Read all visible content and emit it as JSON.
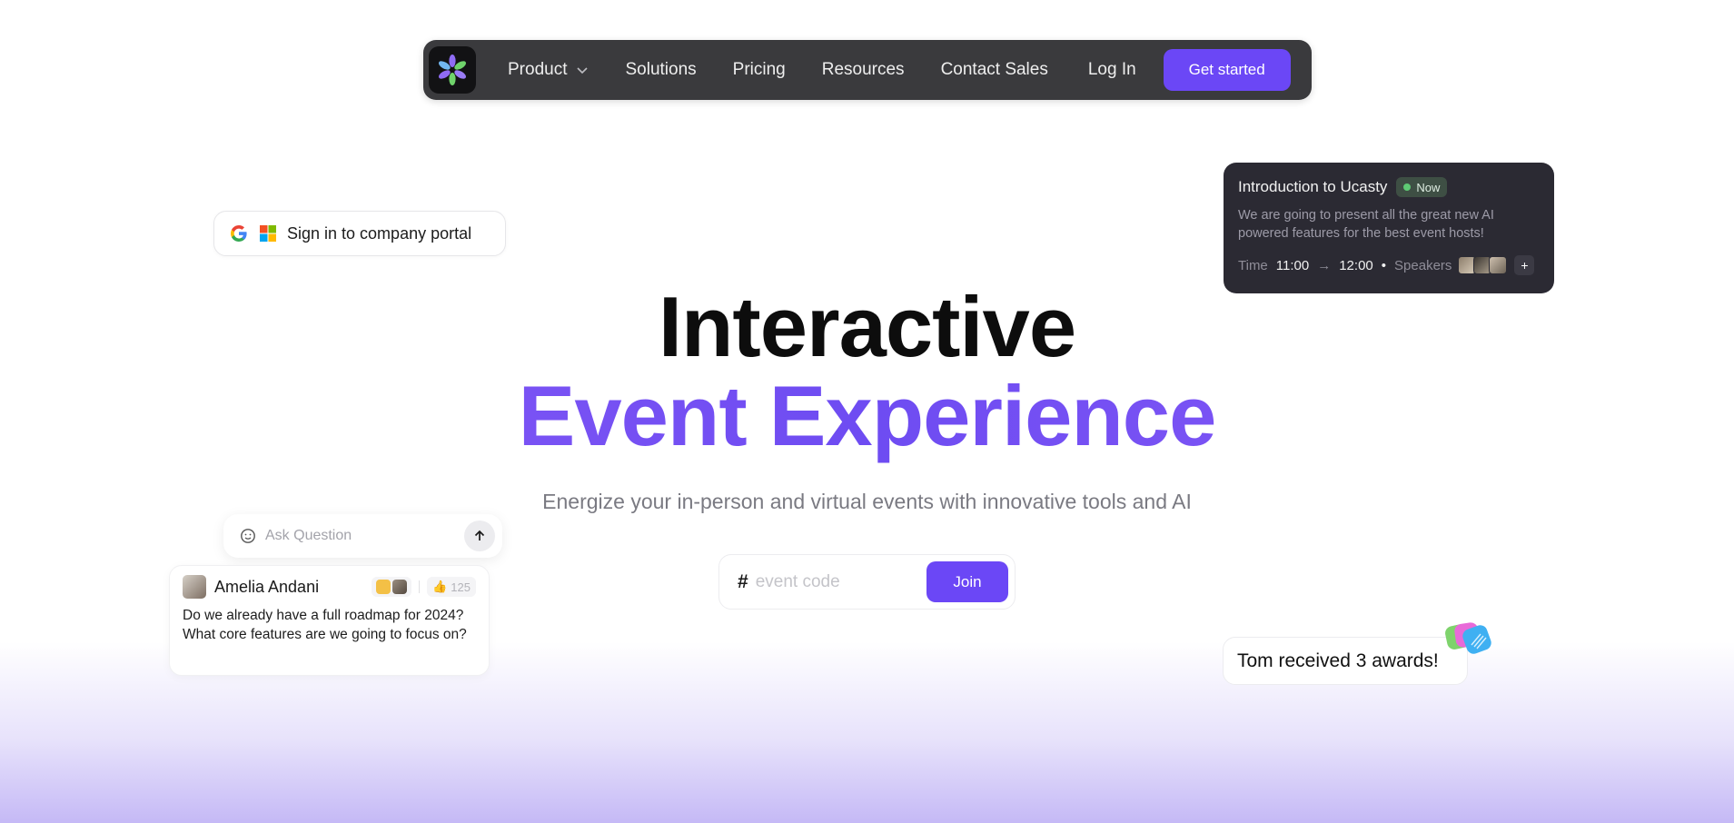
{
  "nav": {
    "items": [
      {
        "label": "Product",
        "has_dropdown": true
      },
      {
        "label": "Solutions"
      },
      {
        "label": "Pricing"
      },
      {
        "label": "Resources"
      },
      {
        "label": "Contact Sales"
      }
    ],
    "login_label": "Log In",
    "cta_label": "Get started"
  },
  "signin": {
    "label": "Sign in to company portal",
    "icons": [
      "google-icon",
      "microsoft-icon"
    ]
  },
  "event_card": {
    "title": "Introduction to Ucasty",
    "badge": "Now",
    "description": "We are going to present all the great new AI powered features for the best event hosts!",
    "time_label": "Time",
    "start": "11:00",
    "arrow": "→",
    "end": "12:00",
    "bullet": "•",
    "speakers_label": "Speakers",
    "plus": "+"
  },
  "hero": {
    "line1": "Interactive",
    "line2": "Event Experience",
    "subtitle": "Energize your in-person and virtual events with innovative tools and AI"
  },
  "event_code": {
    "hash": "#",
    "placeholder": "event code",
    "join_label": "Join"
  },
  "ask": {
    "placeholder": "Ask Question"
  },
  "question": {
    "author": "Amelia Andani",
    "likes": "125",
    "text": "Do we already have a full roadmap for 2024? What core features are we going to focus on?"
  },
  "award": {
    "text": "Tom received 3 awards!"
  },
  "colors": {
    "accent": "#6b47f6",
    "nav_bg": "#3a3a3d",
    "card_bg": "#2b2a33",
    "now_green": "#5ecb74"
  }
}
